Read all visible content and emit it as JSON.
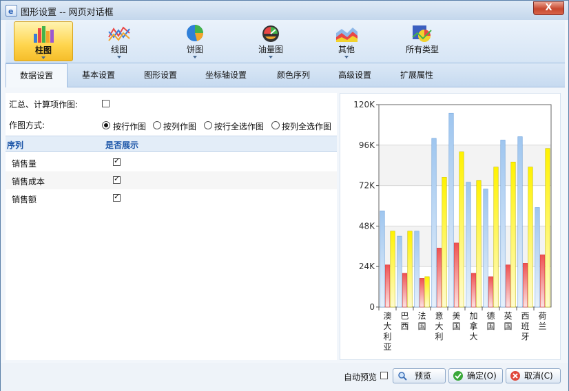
{
  "window": {
    "title": "图形设置 -- 网页对话框",
    "close_label": "X"
  },
  "toolbar": {
    "items": [
      {
        "label": "柱图",
        "icon": "bar-chart-icon",
        "active": true
      },
      {
        "label": "线图",
        "icon": "line-chart-icon"
      },
      {
        "label": "饼图",
        "icon": "pie-chart-icon"
      },
      {
        "label": "油量图",
        "icon": "gauge-chart-icon"
      },
      {
        "label": "其他",
        "icon": "area-chart-icon"
      },
      {
        "label": "所有类型",
        "icon": "all-types-chart-icon"
      }
    ]
  },
  "tabs": [
    "数据设置",
    "基本设置",
    "图形设置",
    "坐标轴设置",
    "颜色序列",
    "高级设置",
    "扩展属性"
  ],
  "form": {
    "summary_label": "汇总、计算项作图:",
    "summary_checked": false,
    "mode_label": "作图方式:",
    "mode_options": [
      "按行作图",
      "按列作图",
      "按行全选作图",
      "按列全选作图"
    ],
    "mode_selected": 0
  },
  "grid": {
    "col_series": "序列",
    "col_show": "是否展示",
    "rows": [
      {
        "name": "销售量",
        "checked": true
      },
      {
        "name": "销售成本",
        "checked": true
      },
      {
        "name": "销售额",
        "checked": true
      }
    ]
  },
  "footer": {
    "auto_preview_label": "自动预览",
    "auto_preview_checked": false,
    "preview_label": "预览",
    "ok_label": "确定(O)",
    "cancel_label": "取消(C)"
  },
  "colors": {
    "series1": "#a9cdf2",
    "series2": "#f06a6a",
    "series3": "#fff000"
  },
  "chart_data": {
    "type": "bar",
    "categories": [
      "澳大利亚",
      "巴西",
      "法国",
      "意大利",
      "美国",
      "加拿大",
      "德国",
      "英国",
      "西班牙",
      "荷兰"
    ],
    "series": [
      {
        "values": [
          57000,
          42000,
          45000,
          100000,
          115000,
          74000,
          70000,
          99000,
          101000,
          59000
        ]
      },
      {
        "values": [
          25000,
          20000,
          17000,
          35000,
          38000,
          20000,
          18000,
          25000,
          26000,
          31000
        ]
      },
      {
        "values": [
          45000,
          45000,
          18000,
          77000,
          92000,
          75000,
          83000,
          86000,
          83000,
          94000
        ]
      }
    ],
    "yticks": [
      "0",
      "24K",
      "48K",
      "72K",
      "96K",
      "120K"
    ],
    "ylim": [
      0,
      120000
    ]
  }
}
